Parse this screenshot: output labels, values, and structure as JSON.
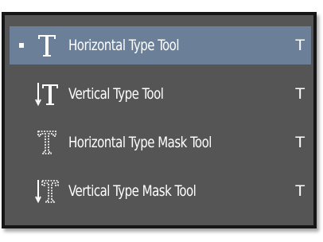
{
  "menu": {
    "items": [
      {
        "label": "Horizontal Type Tool",
        "shortcut": "T",
        "icon": "horizontal-type-icon",
        "selected": true
      },
      {
        "label": "Vertical Type Tool",
        "shortcut": "T",
        "icon": "vertical-type-icon",
        "selected": false
      },
      {
        "label": "Horizontal Type Mask Tool",
        "shortcut": "T",
        "icon": "horizontal-type-mask-icon",
        "selected": false
      },
      {
        "label": "Vertical Type Mask Tool",
        "shortcut": "T",
        "icon": "vertical-type-mask-icon",
        "selected": false
      }
    ]
  },
  "colors": {
    "menu_background": "#555555",
    "selected_background": "#6b7f98",
    "border": "#161616",
    "text": "#ffffff"
  }
}
